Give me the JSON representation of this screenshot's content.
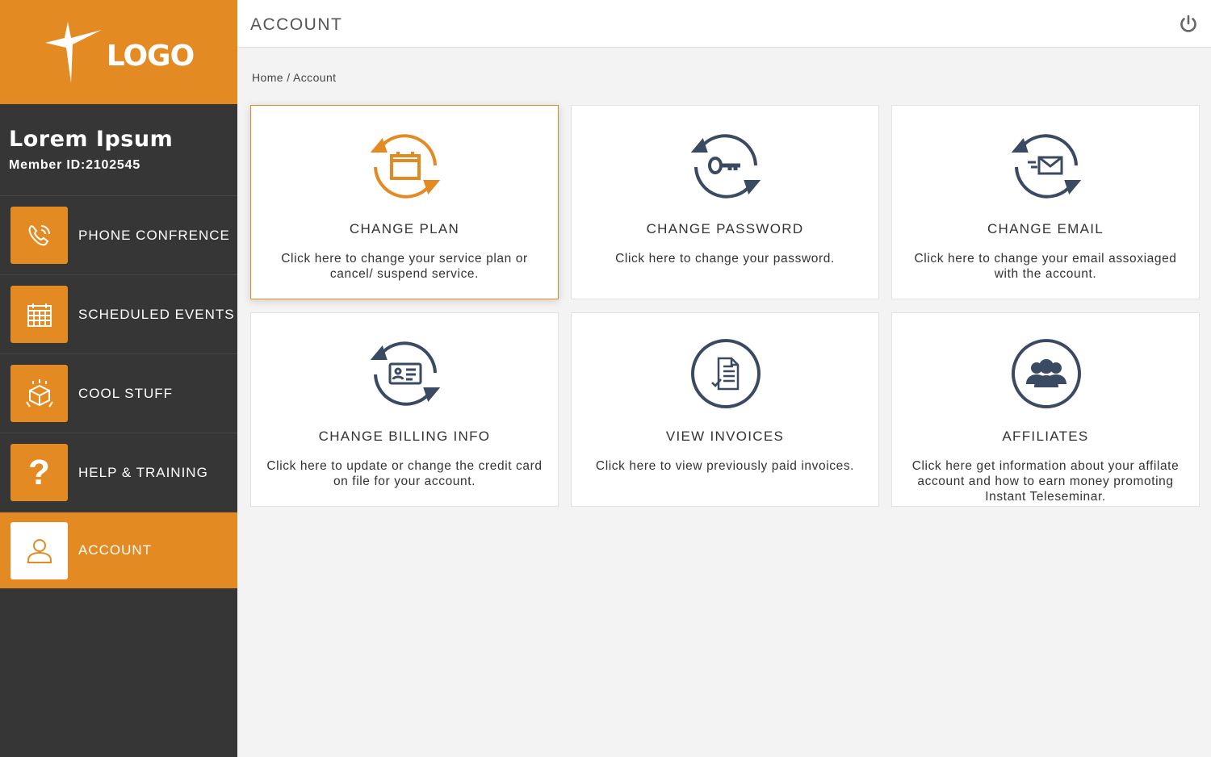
{
  "logo": {
    "text": "LOGO"
  },
  "profile": {
    "name": "Lorem Ipsum",
    "member_id": "Member ID:2102545"
  },
  "nav": [
    {
      "label": "PHONE CONFRENCE",
      "icon": "phone-icon"
    },
    {
      "label": "SCHEDULED EVENTS",
      "icon": "calendar-icon"
    },
    {
      "label": "COOL STUFF",
      "icon": "box-icon"
    },
    {
      "label": "HELP & TRAINING",
      "icon": "question-icon"
    },
    {
      "label": "ACCOUNT",
      "icon": "user-icon",
      "active": true
    }
  ],
  "header": {
    "title": "ACCOUNT"
  },
  "breadcrumb": "Home / Account",
  "cards": [
    {
      "title": "CHANGE PLAN",
      "desc": "Click here to change your service plan or cancel/ suspend service.",
      "icon": "calendar-sync-icon"
    },
    {
      "title": "CHANGE PASSWORD",
      "desc": "Click here to change your password.",
      "icon": "key-sync-icon"
    },
    {
      "title": "CHANGE EMAIL",
      "desc": "Click here to change your email assoxiaged with the account.",
      "icon": "email-sync-icon"
    },
    {
      "title": "CHANGE BILLING INFO",
      "desc": "Click here to update or change the credit card on file for your account.",
      "icon": "id-card-sync-icon"
    },
    {
      "title": "VIEW INVOICES",
      "desc": "Click here to view previously paid invoices.",
      "icon": "invoice-icon"
    },
    {
      "title": "AFFILIATES",
      "desc": "Click here get information about your affilate account and how to earn money promoting Instant Teleseminar.",
      "icon": "group-icon"
    }
  ],
  "colors": {
    "accent": "#e38b22",
    "sidebar": "#363636",
    "icon": "#3a4a63"
  }
}
